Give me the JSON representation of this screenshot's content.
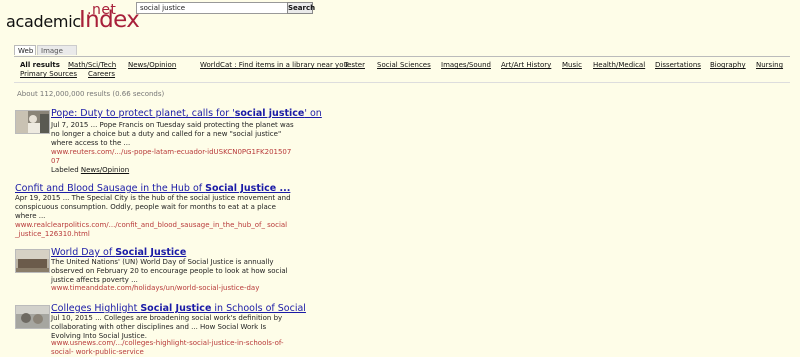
{
  "logo": {
    "word_prefix": "academic",
    "word_main": "Index",
    "tld": ".net"
  },
  "search": {
    "query": "social justice",
    "button_label": "Search"
  },
  "tabs": [
    {
      "label": "Web",
      "active": true
    },
    {
      "label": "Image",
      "active": false
    }
  ],
  "categories": [
    "All results",
    "Math/Sci/Tech",
    "News/Opinion",
    "WorldCat : Find items in a library near you",
    "Tester",
    "Social Sciences",
    "Images/Sound",
    "Art/Art History",
    "Music",
    "Health/Medical",
    "Dissertations",
    "Biography",
    "Nursing",
    "Primary Sources",
    "Careers"
  ],
  "stats": "About 112,000,000 results (0.66 seconds)",
  "results": [
    {
      "title_pre": "Pope: Duty to protect planet, calls for '",
      "title_bold": "social justice",
      "title_post": "' on",
      "snippet": [
        "Jul 7, 2015 ... Pope Francis on Tuesday said protecting the planet was",
        "no longer a choice but a duty and called for a new \"social justice\"",
        "where access to the ..."
      ],
      "url": [
        "www.reuters.com/.../us-pope-latam-ecuador-idUSKCN0PG1FK201507",
        "07"
      ],
      "labeled_prefix": "Labeled ",
      "labeled_link": "News/Opinion",
      "has_thumb": true
    },
    {
      "title_pre": "Confit and Blood Sausage in the Hub of ",
      "title_bold": "Social Justice ...",
      "title_post": "",
      "snippet": [
        "Apr 19, 2015 ... The Special City is the hub of the social justice movement and",
        "conspicuous consumption. Oddly, people wait for months to eat at a place",
        "where ..."
      ],
      "url": [
        "www.realclearpolitics.com/.../confit_and_blood_sausage_in_the_hub_of_ social",
        "_justice_126310.html"
      ],
      "has_thumb": false
    },
    {
      "title_pre": "World Day of ",
      "title_bold": "Social Justice",
      "title_post": "",
      "snippet": [
        "The United Nations' (UN) World Day of Social Justice is annually",
        "observed on February 20 to encourage people to look at how social",
        "justice affects poverty ..."
      ],
      "url": [
        "www.timeanddate.com/holidays/un/world-social-justice-day"
      ],
      "has_thumb": true
    },
    {
      "title_pre": "Colleges Highlight ",
      "title_bold": "Social Justice",
      "title_post": " in Schools of Social",
      "snippet": [
        "Jul 10, 2015 ... Colleges are broadening social work's definition by",
        "collaborating with other disciplines and ... How Social Work Is",
        "Evolving Into Social Justice."
      ],
      "url": [
        "www.usnews.com/.../colleges-highlight-social-justice-in-schools-of-",
        "social- work-public-service"
      ],
      "has_thumb": true
    }
  ]
}
